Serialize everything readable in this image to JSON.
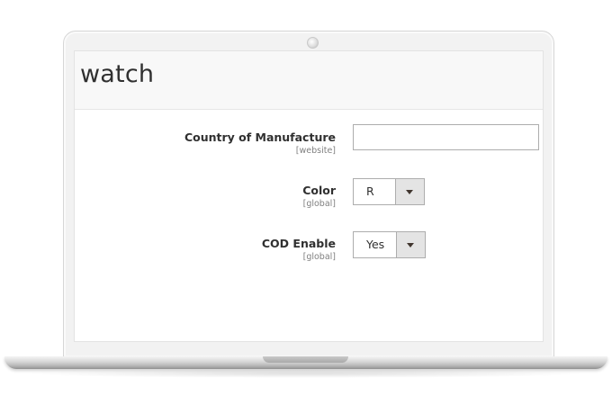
{
  "page": {
    "title": "watch"
  },
  "fields": [
    {
      "label": "Country of Manufacture",
      "scope": "[website]",
      "value": ""
    },
    {
      "label": "Color",
      "scope": "[global]",
      "value": "R"
    },
    {
      "label": "COD Enable",
      "scope": "[global]",
      "value": "Yes"
    }
  ],
  "icons": {
    "dropdown": "chevron-down-icon",
    "camera": "webcam-dot"
  },
  "colors": {
    "header_bg": "#f8f8f8",
    "select_button": "#e4e4e4",
    "text": "#303030",
    "scope_text": "#808080"
  }
}
